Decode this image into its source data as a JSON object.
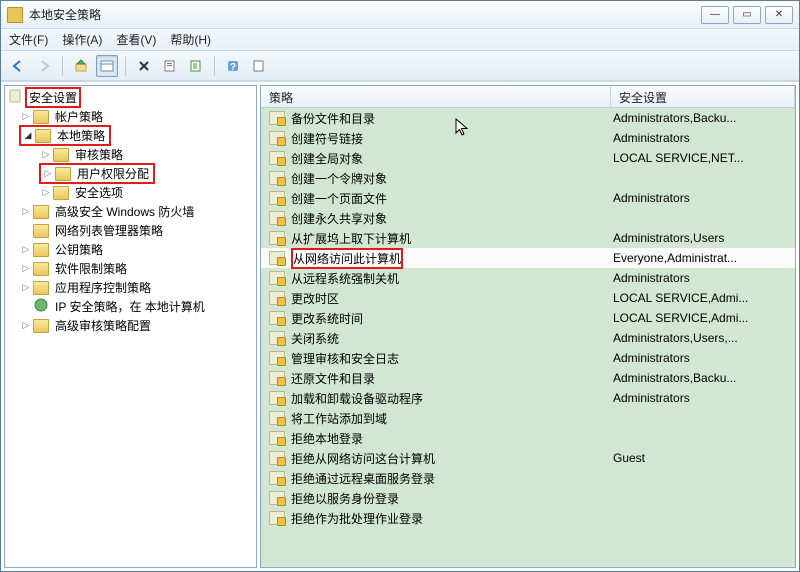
{
  "window": {
    "title": "本地安全策略"
  },
  "menu": {
    "file": "文件(F)",
    "operate": "操作(A)",
    "view": "查看(V)",
    "help": "帮助(H)"
  },
  "columns": {
    "policy": "策略",
    "setting": "安全设置"
  },
  "tree": {
    "root": "安全设置",
    "items": [
      "帐户策略",
      "本地策略",
      "审核策略",
      "用户权限分配",
      "安全选项",
      "高级安全 Windows 防火墙",
      "网络列表管理器策略",
      "公钥策略",
      "软件限制策略",
      "应用程序控制策略",
      "IP 安全策略，在 本地计算机",
      "高级审核策略配置"
    ]
  },
  "rows": [
    {
      "label": "备份文件和目录",
      "value": "Administrators,Backu..."
    },
    {
      "label": "创建符号链接",
      "value": "Administrators"
    },
    {
      "label": "创建全局对象",
      "value": "LOCAL SERVICE,NET..."
    },
    {
      "label": "创建一个令牌对象",
      "value": ""
    },
    {
      "label": "创建一个页面文件",
      "value": "Administrators"
    },
    {
      "label": "创建永久共享对象",
      "value": ""
    },
    {
      "label": "从扩展坞上取下计算机",
      "value": "Administrators,Users"
    },
    {
      "label": "从网络访问此计算机",
      "value": "Everyone,Administrat...",
      "selected": true,
      "redbox": true
    },
    {
      "label": "从远程系统强制关机",
      "value": "Administrators"
    },
    {
      "label": "更改时区",
      "value": "LOCAL SERVICE,Admi..."
    },
    {
      "label": "更改系统时间",
      "value": "LOCAL SERVICE,Admi..."
    },
    {
      "label": "关闭系统",
      "value": "Administrators,Users,..."
    },
    {
      "label": "管理审核和安全日志",
      "value": "Administrators"
    },
    {
      "label": "还原文件和目录",
      "value": "Administrators,Backu..."
    },
    {
      "label": "加载和卸载设备驱动程序",
      "value": "Administrators"
    },
    {
      "label": "将工作站添加到域",
      "value": ""
    },
    {
      "label": "拒绝本地登录",
      "value": ""
    },
    {
      "label": "拒绝从网络访问这台计算机",
      "value": "Guest"
    },
    {
      "label": "拒绝通过远程桌面服务登录",
      "value": ""
    },
    {
      "label": "拒绝以服务身份登录",
      "value": ""
    },
    {
      "label": "拒绝作为批处理作业登录",
      "value": ""
    }
  ]
}
